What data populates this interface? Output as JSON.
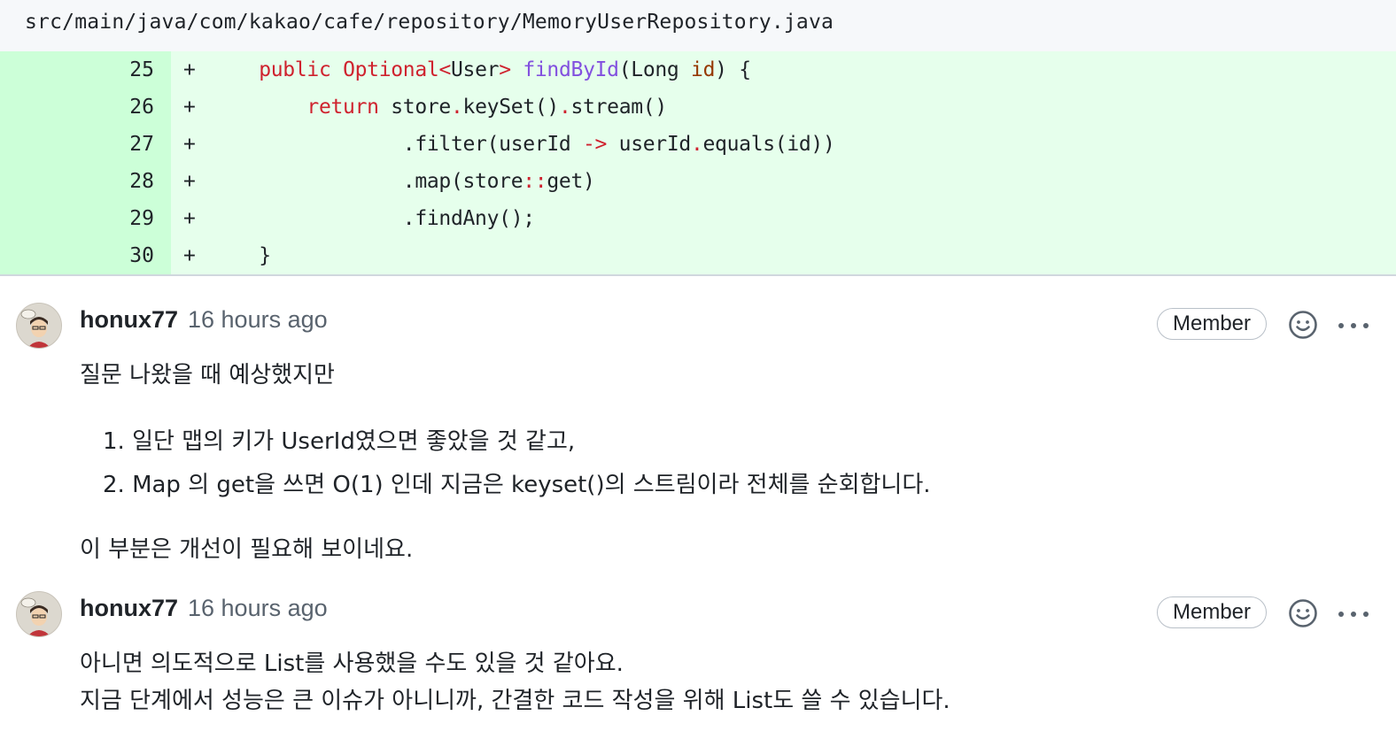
{
  "file": {
    "path": "src/main/java/com/kakao/cafe/repository/MemoryUserRepository.java"
  },
  "diff": {
    "lines": [
      {
        "num": "25",
        "marker": "+"
      },
      {
        "num": "26",
        "marker": "+"
      },
      {
        "num": "27",
        "marker": "+"
      },
      {
        "num": "28",
        "marker": "+"
      },
      {
        "num": "29",
        "marker": "+"
      },
      {
        "num": "30",
        "marker": "+"
      }
    ],
    "code": {
      "l25_indent": "    ",
      "l25_public": "public",
      "l25_sp1": " ",
      "l25_optional": "Optional<",
      "l25_user": "User",
      "l25_gt": ">",
      "l25_sp2": " ",
      "l25_fn": "findById",
      "l25_open": "(Long ",
      "l25_param": "id",
      "l25_close": ") {",
      "l26_indent": "        ",
      "l26_return": "return",
      "l26_a": " store",
      "l26_dot1": ".",
      "l26_b": "keySet()",
      "l26_dot2": ".",
      "l26_c": "stream()",
      "l27_indent": "                ",
      "l27_a": ".filter(userId ",
      "l27_arrow": "->",
      "l27_b": " userId",
      "l27_dot": ".",
      "l27_c": "equals(id))",
      "l28_indent": "                ",
      "l28_a": ".map(store",
      "l28_colon": "::",
      "l28_b": "get)",
      "l29_indent": "                ",
      "l29_a": ".findAny();",
      "l30_indent": "    ",
      "l30_a": "}"
    }
  },
  "comments": [
    {
      "author": "honux77",
      "time": "16 hours ago",
      "badge": "Member",
      "intro": "질문 나왔을 때 예상했지만",
      "items": [
        "1. 일단 맵의 키가 UserId였으면 좋았을 것 같고,",
        "2. Map 의 get을 쓰면 O(1) 인데 지금은 keyset()의 스트림이라 전체를 순회합니다."
      ],
      "outro": "이 부분은 개선이 필요해 보이네요."
    },
    {
      "author": "honux77",
      "time": "16 hours ago",
      "badge": "Member",
      "line1": "아니면 의도적으로 List를 사용했을 수도 있을 것 같아요.",
      "line2": "지금 단계에서 성능은 큰 이슈가 아니니까, 간결한 코드 작성을 위해 List도 쓸 수 있습니다."
    }
  ],
  "icons": {
    "emoji": "smiley-icon",
    "more": "kebab-horizontal-icon",
    "avatar": "avatar-image"
  }
}
